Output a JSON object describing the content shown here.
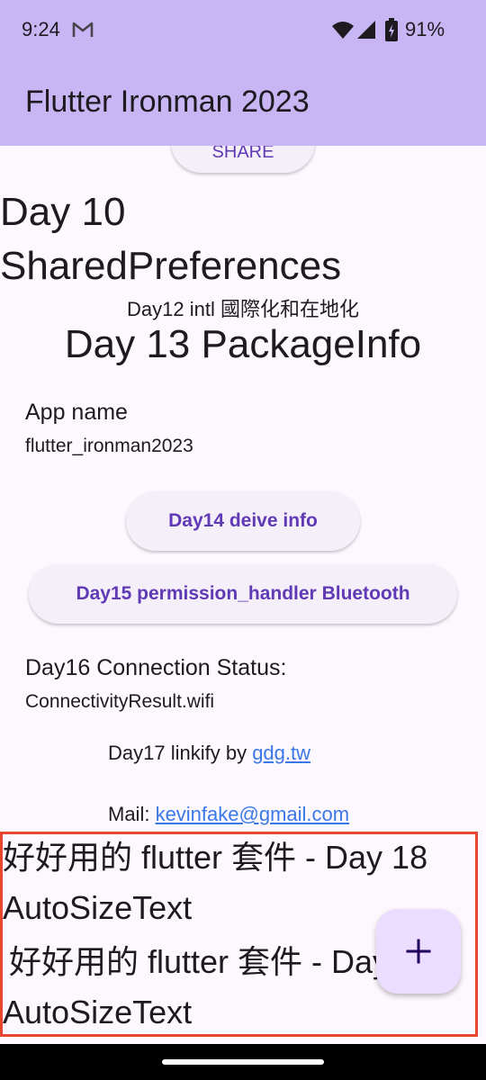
{
  "status_bar": {
    "time": "9:24",
    "battery": "91%",
    "icons": [
      "gmail-icon",
      "wifi-icon",
      "cell-signal-icon",
      "battery-icon"
    ]
  },
  "app_bar": {
    "title": "Flutter Ironman 2023"
  },
  "share_button": {
    "label": "SHARE"
  },
  "day10": {
    "line1": "Day 10",
    "line2": "SharedPreferences"
  },
  "day12": {
    "text": "Day12 intl 國際化和在地化"
  },
  "day13": {
    "title": "Day 13 PackageInfo"
  },
  "package_info": {
    "label": "App name",
    "value": "flutter_ironman2023"
  },
  "day14_button": {
    "label": "Day14 deive info"
  },
  "day15_button": {
    "label": "Day15 permission_handler Bluetooth"
  },
  "connection": {
    "label": "Day16 Connection Status:",
    "value": "ConnectivityResult.wifi"
  },
  "linkify": {
    "prefix": "Day17 linkify by ",
    "link": "gdg.tw",
    "mail_prefix": "Mail: ",
    "mail_link": "kevinfake@gmail.com"
  },
  "auto_size_text": {
    "line1": "好好用的 flutter 套件 - Day 18",
    "line2": "AutoSizeText",
    "line3": "好好用的 flutter 套件 - Day 18",
    "line4": "AutoSizeText"
  },
  "fab": {
    "icon": "add-icon",
    "label": "+"
  },
  "colors": {
    "app_bar": "#c7b6f3",
    "background": "#fdf7fe",
    "button_text": "#6039b5",
    "link": "#3b78e7",
    "highlight": "#e8472f",
    "fab": "#eaddff"
  }
}
